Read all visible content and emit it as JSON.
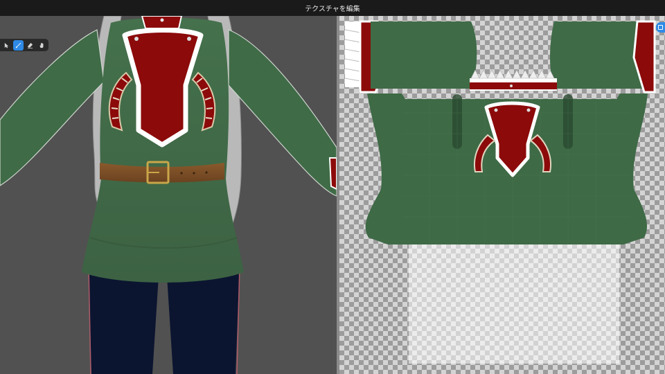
{
  "window": {
    "title": "テクスチャを編集"
  },
  "toolbar": {
    "tools": [
      {
        "name": "select",
        "icon": "cursor-icon",
        "active": false
      },
      {
        "name": "brush",
        "icon": "brush-icon",
        "active": true
      },
      {
        "name": "eraser",
        "icon": "eraser-icon",
        "active": false
      },
      {
        "name": "hand",
        "icon": "hand-icon",
        "active": false
      }
    ]
  },
  "colors": {
    "accent": "#2f8ae6",
    "coat_green": "#3f6a47",
    "panel_red": "#8c0a0a",
    "trim_white": "#ffffff",
    "belt_brown": "#7a4d26",
    "pants_navy": "#0b1530",
    "viewport_bg": "#515151"
  }
}
